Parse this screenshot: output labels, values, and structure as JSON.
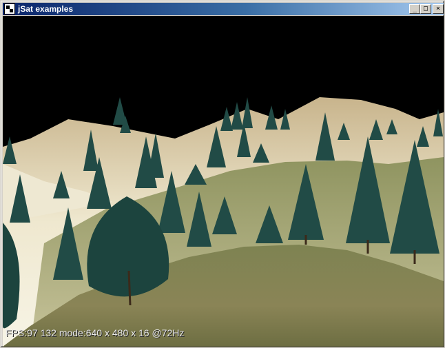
{
  "window": {
    "title": "jSat examples",
    "buttons": {
      "minimize_icon": "minimize-icon",
      "maximize_icon": "maximize-icon",
      "close_icon": "close-icon"
    }
  },
  "scene": {
    "sky_color": "#000000",
    "terrain_light": "#eae3c8",
    "terrain_grass": "#8c8d5a",
    "tree_color": "#1f4a45"
  },
  "overlay": {
    "fps_text": "FPS:97 132 mode:640 x 480 x 16 @72Hz"
  }
}
